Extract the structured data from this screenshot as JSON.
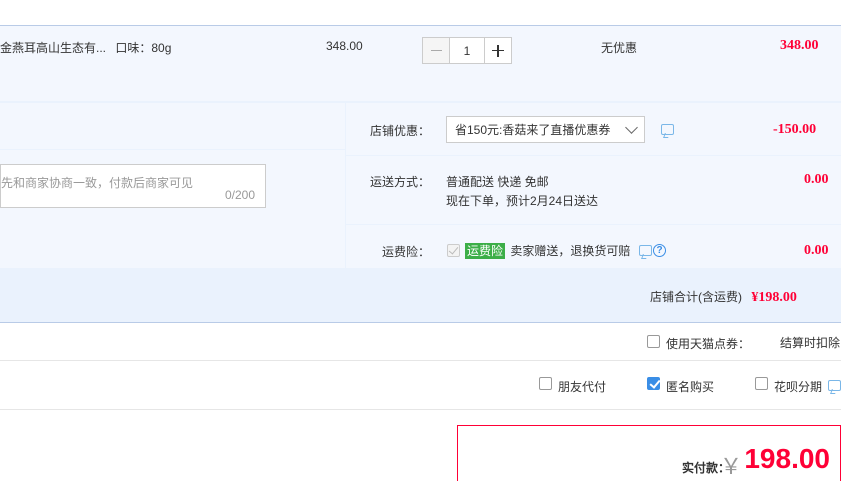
{
  "product": {
    "name": "金燕耳高山生态有...",
    "attr": "口味：80g",
    "price": "348.00",
    "quantity": "1",
    "discount": "无优惠",
    "total": "348.00"
  },
  "order": {
    "memo_placeholder": "先和商家协商一致，付款后商家可见",
    "memo_count": "0/200",
    "shop_discount_label": "店铺优惠：",
    "shop_discount_option": "省150元:香菇来了直播优惠券",
    "shop_discount_value": "-150.00",
    "shipping_label": "运送方式：",
    "shipping_line1": "普通配送 快递 免邮",
    "shipping_line2": "现在下单，预计2月24日送达",
    "shipping_value": "0.00",
    "insurance_label": "运费险：",
    "insurance_tag": "运费险",
    "insurance_text": "卖家赠送，退换货可赔",
    "insurance_value": "0.00",
    "shop_total_label": "店铺合计(含运费)",
    "shop_total_value": "¥198.00"
  },
  "options": {
    "tmall_coupon_label": "使用天猫点券：",
    "tmall_coupon_note": "结算时扣除",
    "friend_pay_label": "朋友代付",
    "anonymous_label": "匿名购买",
    "huabei_label": "花呗分期"
  },
  "payment": {
    "label": "实付款：",
    "currency": "￥",
    "amount": "198.00"
  }
}
